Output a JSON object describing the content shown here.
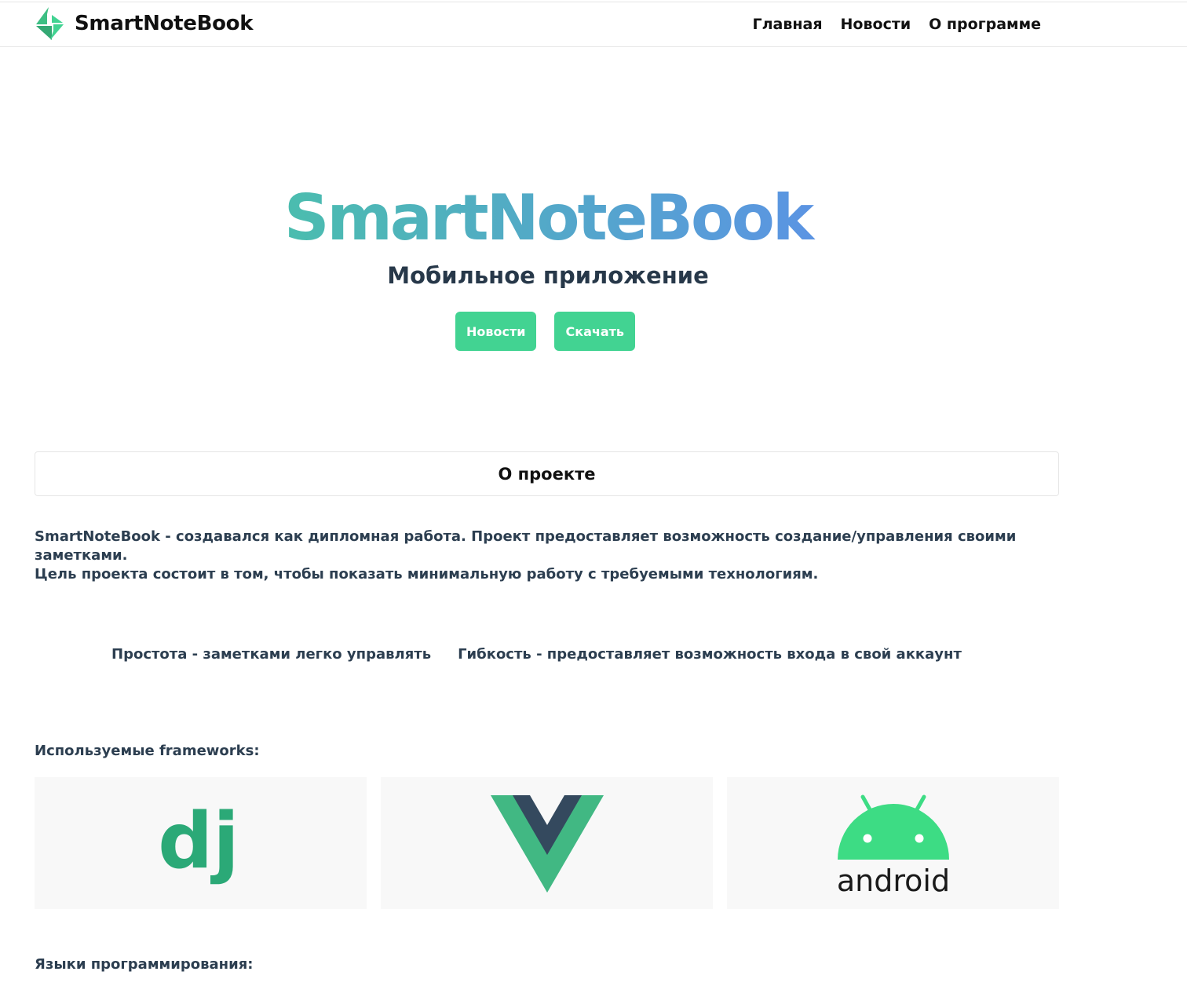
{
  "header": {
    "brand": "SmartNoteBook",
    "nav": [
      {
        "label": "Главная"
      },
      {
        "label": "Новости"
      },
      {
        "label": "О программе"
      }
    ]
  },
  "hero": {
    "title": "SmartNoteBook",
    "subtitle": "Мобильное приложение",
    "buttons": [
      {
        "label": "Новости"
      },
      {
        "label": "Скачать"
      }
    ]
  },
  "about": {
    "title": "О проекте",
    "paragraph1": "SmartNoteBook - создавался как дипломная работа. Проект предоставляет возможность создание/управления своими заметками.",
    "paragraph2": "Цель проекта состоит в том, чтобы показать минимальную работу с требуемыми технологиям.",
    "features": [
      "Простота - заметками легко управлять",
      "Гибкость - предоставляет возможность входа в свой аккаунт"
    ]
  },
  "frameworks": {
    "heading": "Используемые frameworks:",
    "items": [
      {
        "name": "django",
        "logo_text": "dj",
        "color": "#2ba977"
      },
      {
        "name": "vue",
        "colors": [
          "#41b883",
          "#34495e"
        ]
      },
      {
        "name": "android",
        "logo_text": "android",
        "color": "#3ddc84"
      }
    ]
  },
  "languages": {
    "heading": "Языки программирования:"
  },
  "colors": {
    "accent": "#42d392",
    "gradient_start": "#42d392",
    "gradient_end": "#647eff",
    "text": "#2c3e50"
  }
}
